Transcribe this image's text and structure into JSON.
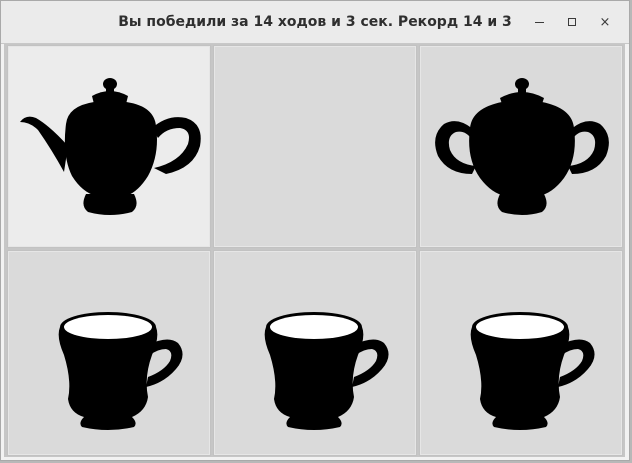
{
  "window": {
    "title": "Вы победили за 14 ходов и 3 сек. Рекорд 14 и 3"
  },
  "controls": {
    "minimize_icon": "minimize-icon",
    "maximize_icon": "maximize-icon",
    "close_icon": "close-icon",
    "close_glyph": "×"
  },
  "board": {
    "rows": 2,
    "cols": 3,
    "cells": [
      {
        "piece": "teapot-icon",
        "state": "selected"
      },
      {
        "piece": "",
        "state": "empty"
      },
      {
        "piece": "sugar-bowl-icon",
        "state": "normal"
      },
      {
        "piece": "cup-icon",
        "state": "normal"
      },
      {
        "piece": "cup-icon",
        "state": "normal"
      },
      {
        "piece": "cup-icon",
        "state": "normal"
      }
    ]
  },
  "colors": {
    "silhouette": "#000000",
    "cup_inside": "#ffffff",
    "cell_bg": "#dadada",
    "cell_selected_bg": "#ececec"
  }
}
